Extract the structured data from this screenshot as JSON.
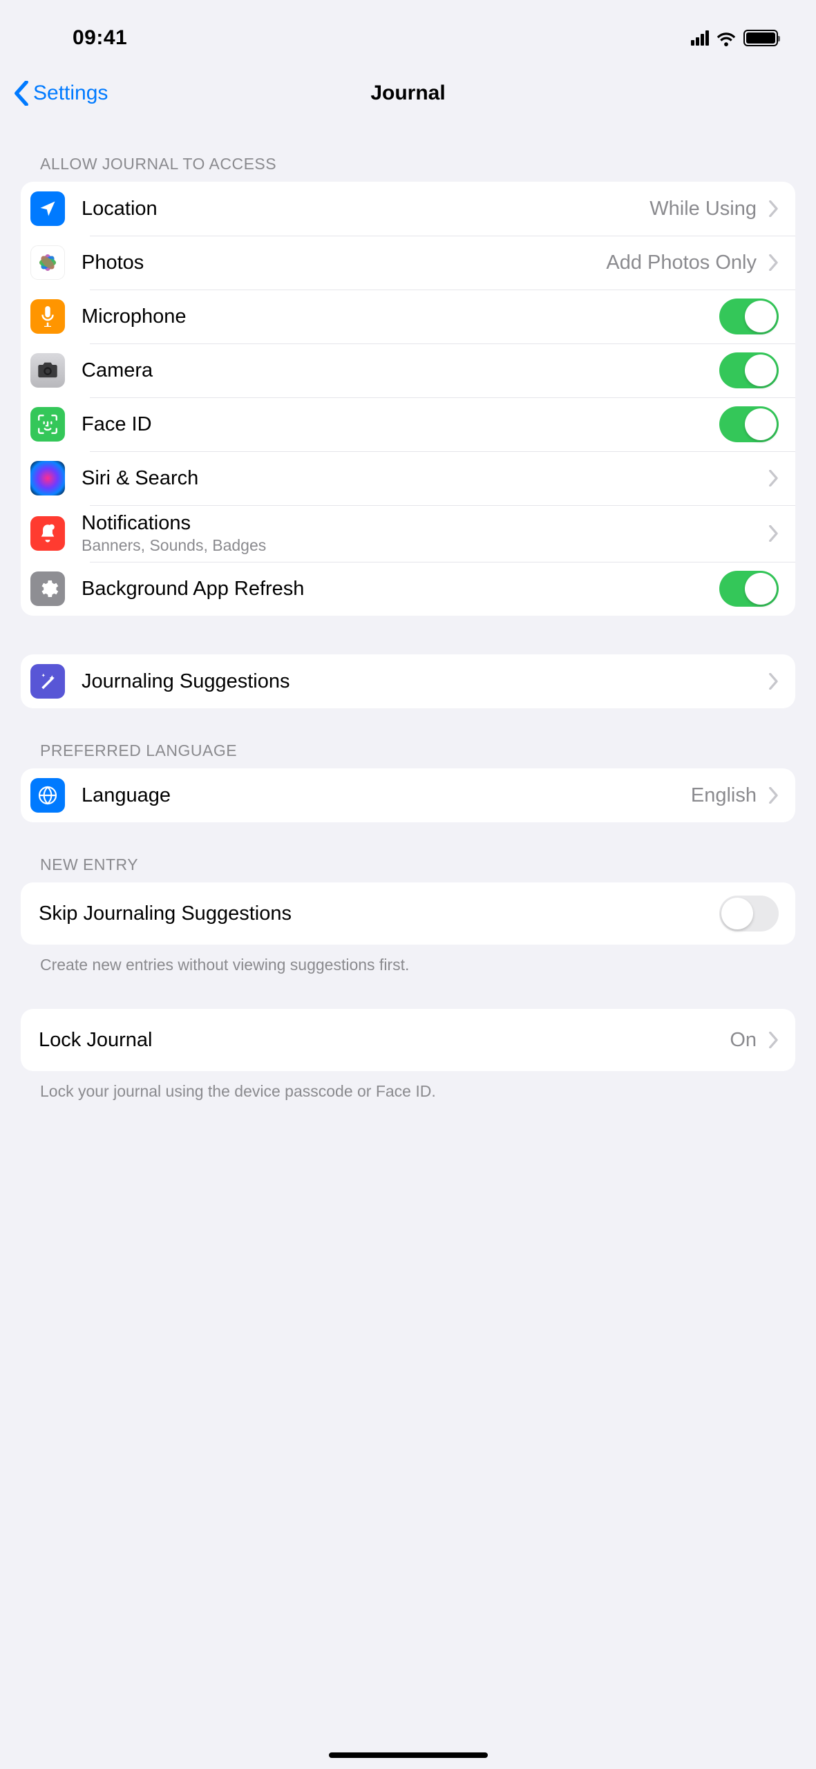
{
  "status": {
    "time": "09:41"
  },
  "nav": {
    "back": "Settings",
    "title": "Journal"
  },
  "sections": {
    "access": {
      "header": "Allow Journal to Access",
      "location": {
        "label": "Location",
        "value": "While Using"
      },
      "photos": {
        "label": "Photos",
        "value": "Add Photos Only"
      },
      "microphone": {
        "label": "Microphone",
        "on": true
      },
      "camera": {
        "label": "Camera",
        "on": true
      },
      "faceid": {
        "label": "Face ID",
        "on": true
      },
      "siri": {
        "label": "Siri & Search"
      },
      "notifications": {
        "label": "Notifications",
        "sublabel": "Banners, Sounds, Badges"
      },
      "refresh": {
        "label": "Background App Refresh",
        "on": true
      }
    },
    "suggestions": {
      "label": "Journaling Suggestions"
    },
    "language": {
      "header": "Preferred Language",
      "label": "Language",
      "value": "English"
    },
    "newentry": {
      "header": "New Entry",
      "skip": {
        "label": "Skip Journaling Suggestions",
        "on": false
      },
      "footer": "Create new entries without viewing suggestions first."
    },
    "lock": {
      "label": "Lock Journal",
      "value": "On",
      "footer": "Lock your journal using the device passcode or Face ID."
    }
  }
}
